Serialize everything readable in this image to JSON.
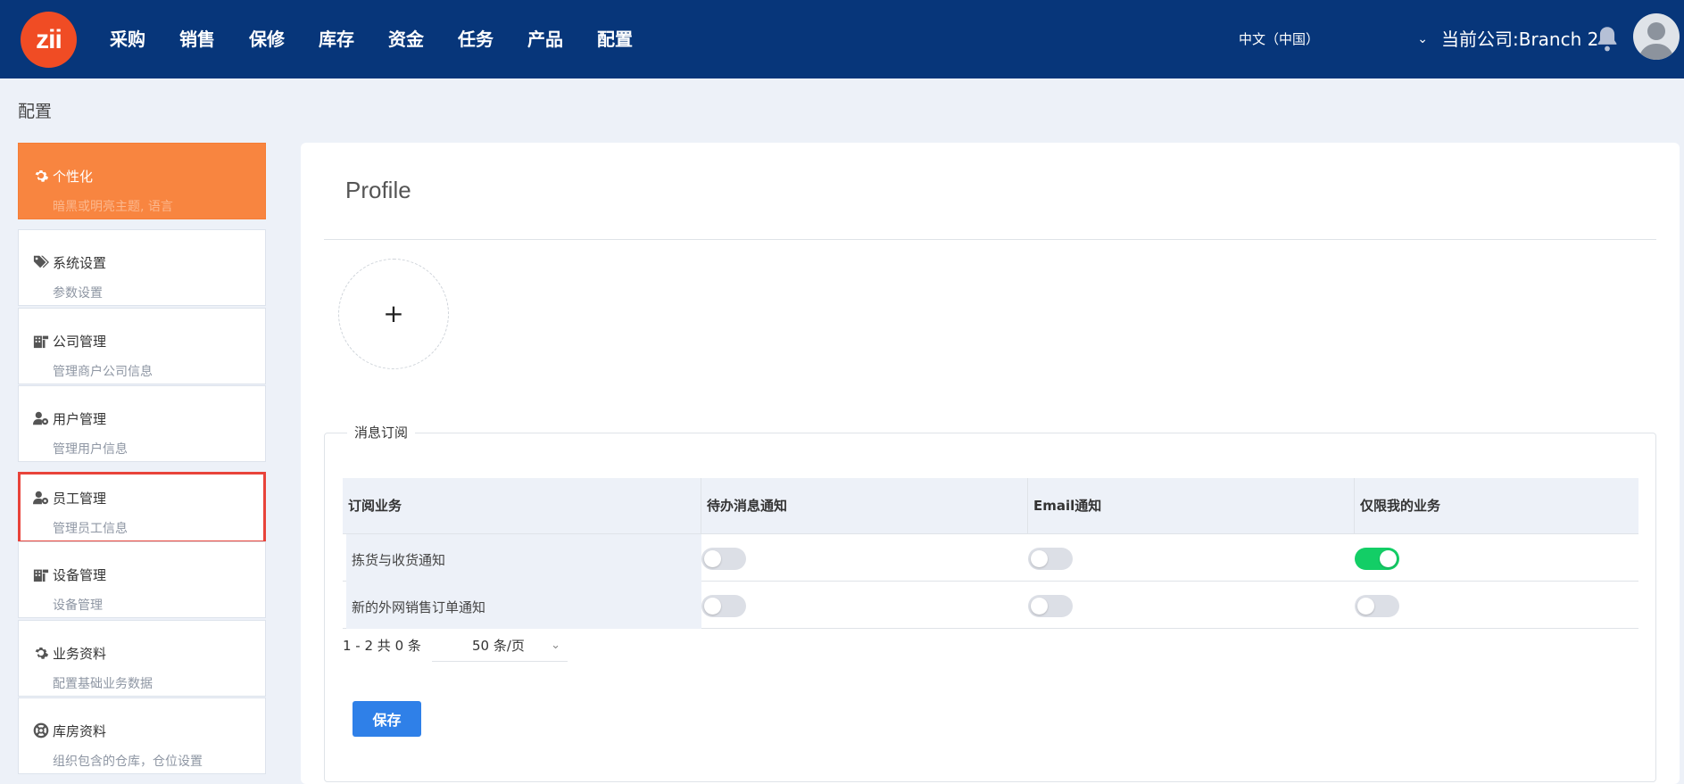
{
  "header": {
    "logo_text": "zii",
    "nav": [
      "采购",
      "销售",
      "保修",
      "库存",
      "资金",
      "任务",
      "产品",
      "配置"
    ],
    "language": "中文（中国）",
    "company": "当前公司:Branch 2"
  },
  "page_title": "配置",
  "sidebar": {
    "items": [
      {
        "title": "个性化",
        "subtitle": "暗黑或明亮主题, 语言",
        "icon": "gear-icon",
        "state": "active"
      },
      {
        "title": "系统设置",
        "subtitle": "参数设置",
        "icon": "tags-icon"
      },
      {
        "title": "公司管理",
        "subtitle": "管理商户公司信息",
        "icon": "building-icon"
      },
      {
        "title": "用户管理",
        "subtitle": "管理用户信息",
        "icon": "user-gear-icon"
      },
      {
        "title": "员工管理",
        "subtitle": "管理员工信息",
        "icon": "user-gear-icon",
        "state": "selected"
      },
      {
        "title": "设备管理",
        "subtitle": "设备管理",
        "icon": "building-icon"
      },
      {
        "title": "业务资料",
        "subtitle": "配置基础业务数据",
        "icon": "gear-icon"
      },
      {
        "title": "库房资料",
        "subtitle": "组织包含的仓库，仓位设置",
        "icon": "lifebuoy-icon"
      }
    ]
  },
  "profile": {
    "title": "Profile",
    "upload_symbol": "+"
  },
  "subscription": {
    "legend": "消息订阅",
    "columns": [
      "订阅业务",
      "待办消息通知",
      "Email通知",
      "仅限我的业务"
    ],
    "rows": [
      {
        "name": "拣货与收货通知",
        "todo": false,
        "email": false,
        "mine": true
      },
      {
        "name": "新的外网销售订单通知",
        "todo": false,
        "email": false,
        "mine": false
      }
    ],
    "pager": {
      "count": "1 - 2 共 0 条",
      "page_size": "50 条/页"
    },
    "save_label": "保存"
  },
  "colors": {
    "header_bg": "#07367a",
    "logo_bg": "#f04c24",
    "active_item": "#f88540",
    "toggle_on": "#13ce66",
    "primary": "#2f80e8",
    "selected_border": "#e8433a"
  }
}
